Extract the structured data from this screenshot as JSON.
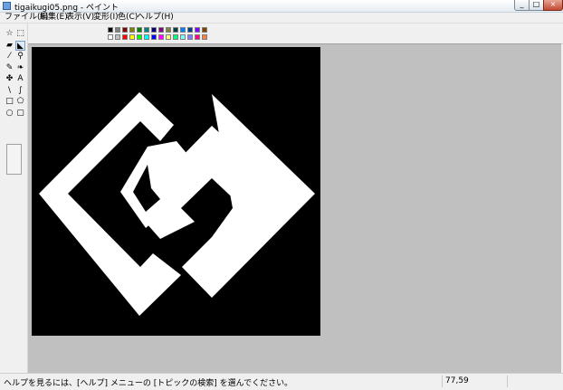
{
  "window": {
    "title": "tigaikugi05.png - ペイント"
  },
  "menu": [
    "ファイル(F)",
    "編集(E)",
    "表示(V)",
    "変形(I)",
    "色(C)",
    "ヘルプ(H)"
  ],
  "tools": [
    "free-select-icon",
    "rect-select-icon",
    "eraser-icon",
    "fill-icon",
    "eyedropper-icon",
    "magnifier-icon",
    "pencil-icon",
    "brush-icon",
    "airbrush-icon",
    "text-icon",
    "line-icon",
    "curve-icon",
    "rectangle-icon",
    "polygon-icon",
    "ellipse-icon",
    "rounded-rect-icon"
  ],
  "active_tool": "fill-icon",
  "palette": {
    "foreground": "#000000",
    "background": "#ffffff",
    "colors_top": [
      "#000000",
      "#808080",
      "#800000",
      "#808000",
      "#008000",
      "#008080",
      "#000080",
      "#800080",
      "#808040",
      "#004040",
      "#0080ff",
      "#004080",
      "#8000ff",
      "#804000"
    ],
    "colors_bottom": [
      "#ffffff",
      "#c0c0c0",
      "#ff0000",
      "#ffff00",
      "#00ff00",
      "#00ffff",
      "#0000ff",
      "#ff00ff",
      "#ffff80",
      "#00ff80",
      "#80ffff",
      "#8080ff",
      "#ff0080",
      "#ff8040"
    ]
  },
  "canvas": {
    "background": "#000000",
    "foreground": "#ffffff"
  },
  "status": {
    "help_text": "ヘルプを見るには、[ヘルプ] メニューの [トピックの検索] を選んでください。",
    "coordinates": "77,59"
  }
}
